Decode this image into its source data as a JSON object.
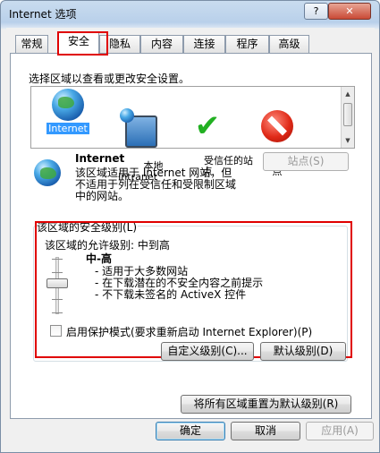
{
  "window": {
    "title": "Internet 选项",
    "help_label": "?",
    "close_label": "✕"
  },
  "tabs": [
    {
      "label": "常规"
    },
    {
      "label": "安全"
    },
    {
      "label": "隐私"
    },
    {
      "label": "内容"
    },
    {
      "label": "连接"
    },
    {
      "label": "程序"
    },
    {
      "label": "高级"
    }
  ],
  "active_tab": "安全",
  "zones_prompt": "选择区域以查看或更改安全设置。",
  "zones": [
    {
      "label": "Internet",
      "icon": "globe-icon",
      "selected": true
    },
    {
      "label": "本地\nIntranet",
      "icon": "local-intranet-icon",
      "selected": false
    },
    {
      "label": "受信任的站\n点",
      "icon": "trusted-sites-icon",
      "selected": false
    },
    {
      "label": "受限制的站\n点",
      "icon": "restricted-sites-icon",
      "selected": false
    }
  ],
  "zone_detail": {
    "title": "Internet",
    "description": "该区域适用于 Internet 网站，但\n不适用于列在受信任和受限制区域\n中的网站。",
    "sites_button": "站点(S)"
  },
  "security_level": {
    "group_title": "该区域的安全级别(L)",
    "allowed_levels": "该区域的允许级别: 中到高",
    "level_name": "中-高",
    "bullets": "- 适用于大多数网站\n- 在下载潜在的不安全内容之前提示\n- 不下载未签名的 ActiveX 控件",
    "protected_mode_label": "启用保护模式(要求重新启动 Internet Explorer)(P)",
    "protected_mode_checked": false,
    "custom_level_button": "自定义级别(C)...",
    "default_level_button": "默认级别(D)"
  },
  "reset_all_button": "将所有区域重置为默认级别(R)",
  "footer": {
    "ok": "确定",
    "cancel": "取消",
    "apply": "应用(A)"
  },
  "colors": {
    "highlight_box": "#e00000",
    "selection": "#3399ff"
  }
}
